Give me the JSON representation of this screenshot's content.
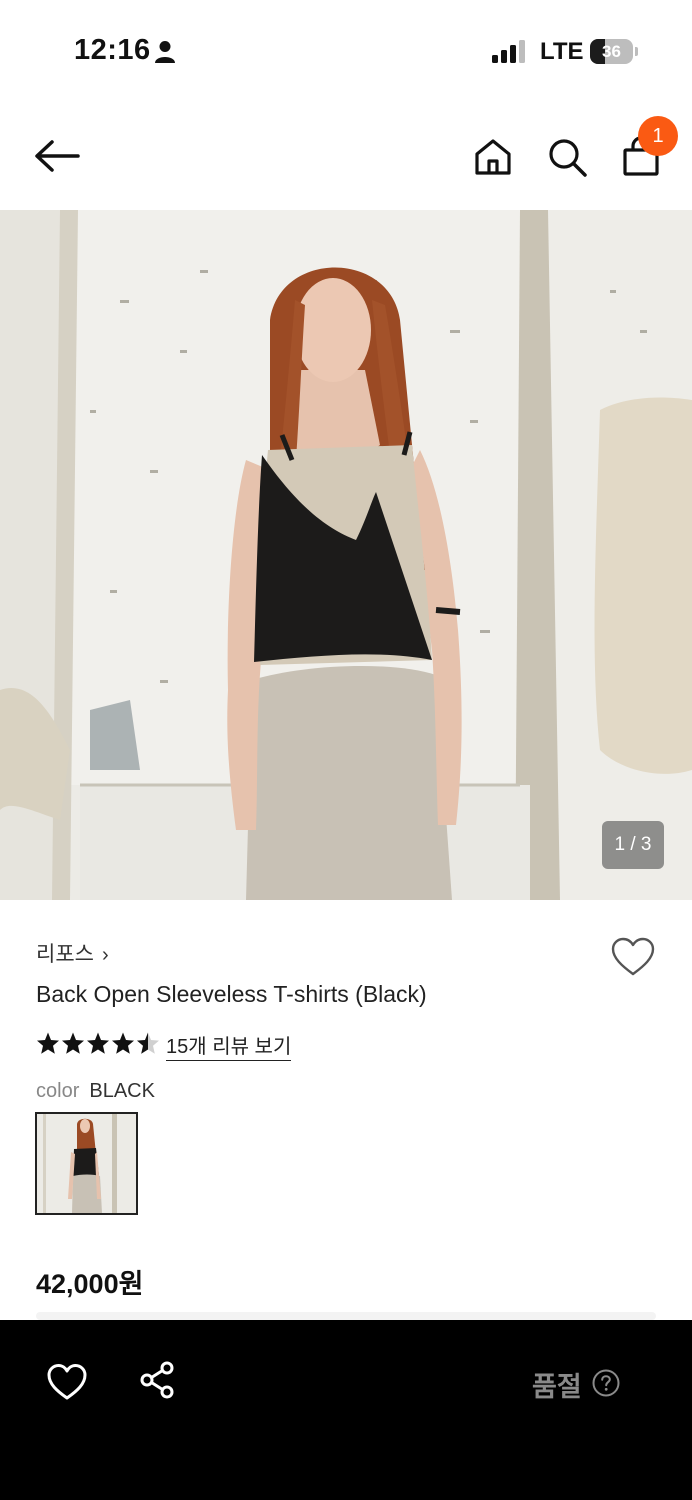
{
  "status_bar": {
    "time": "12:16",
    "network": "LTE",
    "battery": "36",
    "battery_level": 0.36,
    "icons": [
      "person-icon",
      "signal-icon",
      "battery-icon"
    ]
  },
  "header": {
    "icons": [
      "back-arrow-icon",
      "home-icon",
      "search-icon",
      "shopping-bag-icon"
    ],
    "cart_count": "1",
    "badge_color": "#fa5a13"
  },
  "product": {
    "image_counter": "1 / 3",
    "brand": "리포스",
    "brand_chevron": "›",
    "title": "Back Open Sleeveless T-shirts (Black)",
    "rating": 4.5,
    "review_link": "15개 리뷰 보기",
    "color_label": "color",
    "color_value": "BLACK",
    "price": "42,000원"
  },
  "bottom_bar": {
    "status": "품절",
    "icons": [
      "heart-icon",
      "share-icon",
      "help-icon"
    ]
  }
}
